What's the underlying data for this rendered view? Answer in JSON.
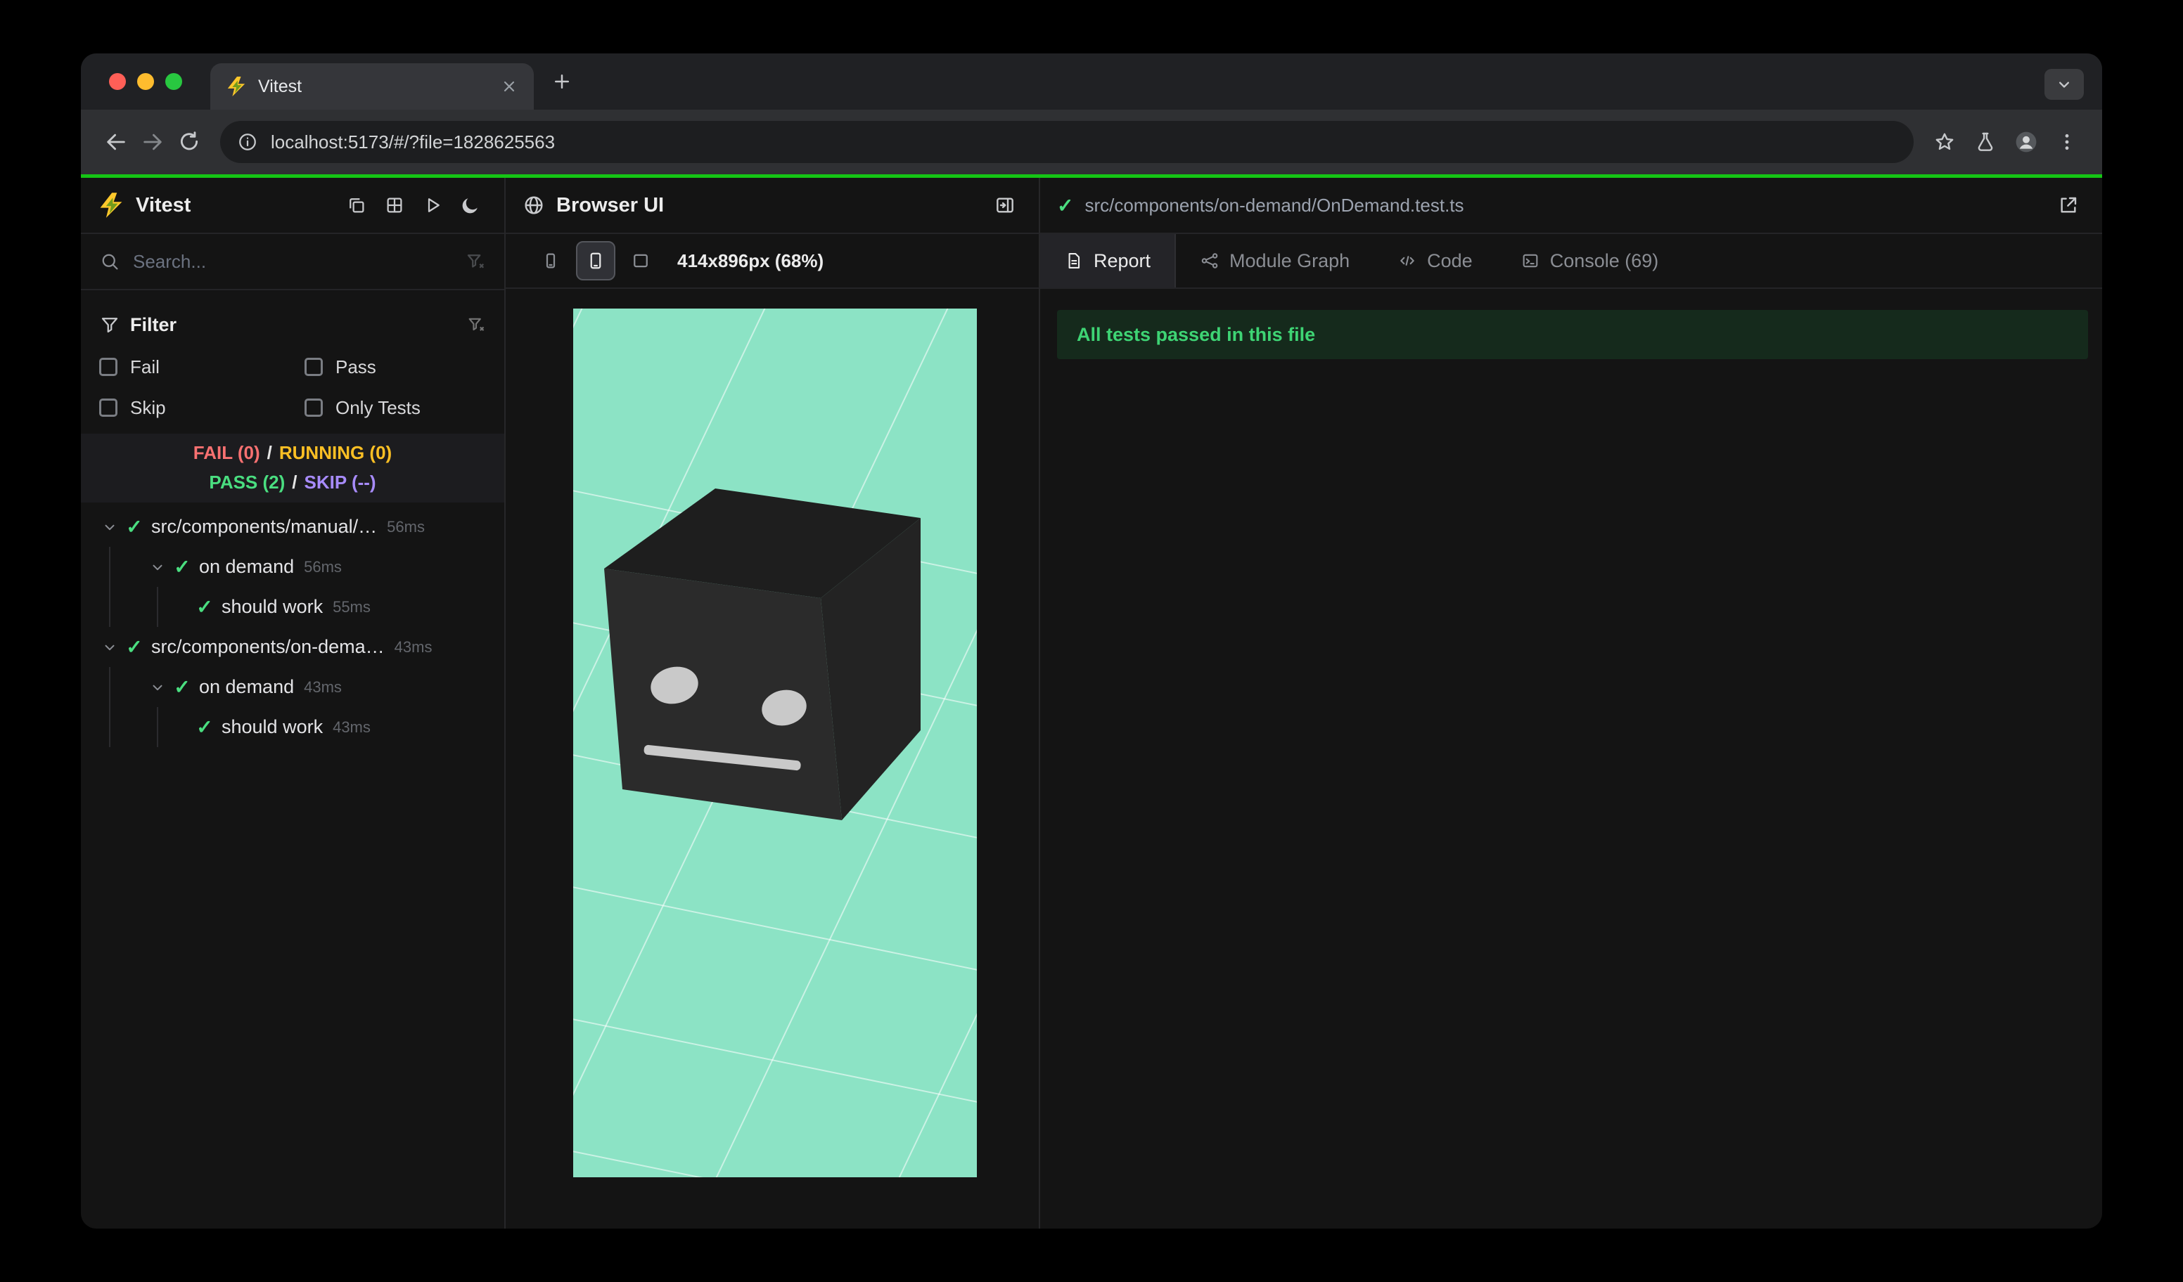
{
  "browser": {
    "tab_title": "Vitest",
    "url": "localhost:5173/#/?file=1828625563"
  },
  "sidebar": {
    "app_title": "Vitest",
    "search_placeholder": "Search...",
    "filter": {
      "title": "Filter",
      "options": [
        {
          "label": "Fail",
          "checked": false
        },
        {
          "label": "Pass",
          "checked": false
        },
        {
          "label": "Skip",
          "checked": false
        },
        {
          "label": "Only Tests",
          "checked": false
        }
      ]
    },
    "summary": {
      "fail": "FAIL (0)",
      "running": "RUNNING (0)",
      "pass": "PASS (2)",
      "skip": "SKIP (--)",
      "separator": "/"
    },
    "tree": [
      {
        "label": "src/components/manual/…",
        "time": "56ms",
        "level": 0,
        "status": "pass"
      },
      {
        "label": "on demand",
        "time": "56ms",
        "level": 1,
        "status": "pass"
      },
      {
        "label": "should work",
        "time": "55ms",
        "level": 2,
        "status": "pass"
      },
      {
        "label": "src/components/on-dema…",
        "time": "43ms",
        "level": 0,
        "status": "pass"
      },
      {
        "label": "on demand",
        "time": "43ms",
        "level": 1,
        "status": "pass"
      },
      {
        "label": "should work",
        "time": "43ms",
        "level": 2,
        "status": "pass"
      }
    ]
  },
  "browser_panel": {
    "title": "Browser UI",
    "viewport_label": "414x896px (68%)"
  },
  "report_panel": {
    "file_path": "src/components/on-demand/OnDemand.test.ts",
    "tabs": [
      {
        "label": "Report",
        "active": true
      },
      {
        "label": "Module Graph",
        "active": false
      },
      {
        "label": "Code",
        "active": false
      },
      {
        "label": "Console (69)",
        "active": false
      }
    ],
    "banner_text": "All tests passed in this file"
  },
  "colors": {
    "progress_green": "#15c515",
    "pass_green": "#4ade80",
    "fail_red": "#f87171",
    "running_yellow": "#fbbf24",
    "skip_purple": "#a78bfa",
    "preview_background": "#8CE3C5"
  }
}
